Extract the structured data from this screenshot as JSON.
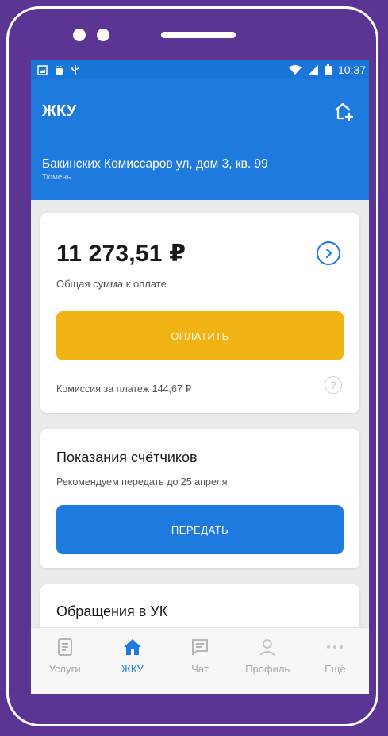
{
  "status": {
    "time": "10:37"
  },
  "header": {
    "title": "ЖКУ"
  },
  "address": {
    "street": "Бакинских Комиссаров ул, дом 3, кв. 99",
    "city": "Тюмень"
  },
  "payment": {
    "amount": "11 273,51 ₽",
    "amount_label": "Общая сумма к оплате",
    "pay_button": "ОПЛАТИТЬ",
    "fee": "Комиссия за платеж 144,67 ₽",
    "help_icon": "?"
  },
  "meters": {
    "title": "Показания счётчиков",
    "subtitle": "Рекомендуем передать до 25 апреля",
    "submit_button": "ПЕРЕДАТЬ"
  },
  "requests": {
    "title": "Обращения в УК"
  },
  "tabs": [
    {
      "label": "Услуги"
    },
    {
      "label": "ЖКУ"
    },
    {
      "label": "Чат"
    },
    {
      "label": "Профиль"
    },
    {
      "label": "Ещё"
    }
  ],
  "colors": {
    "primary": "#1f7ae0",
    "accent": "#f2b315",
    "frame": "#5b3494"
  }
}
